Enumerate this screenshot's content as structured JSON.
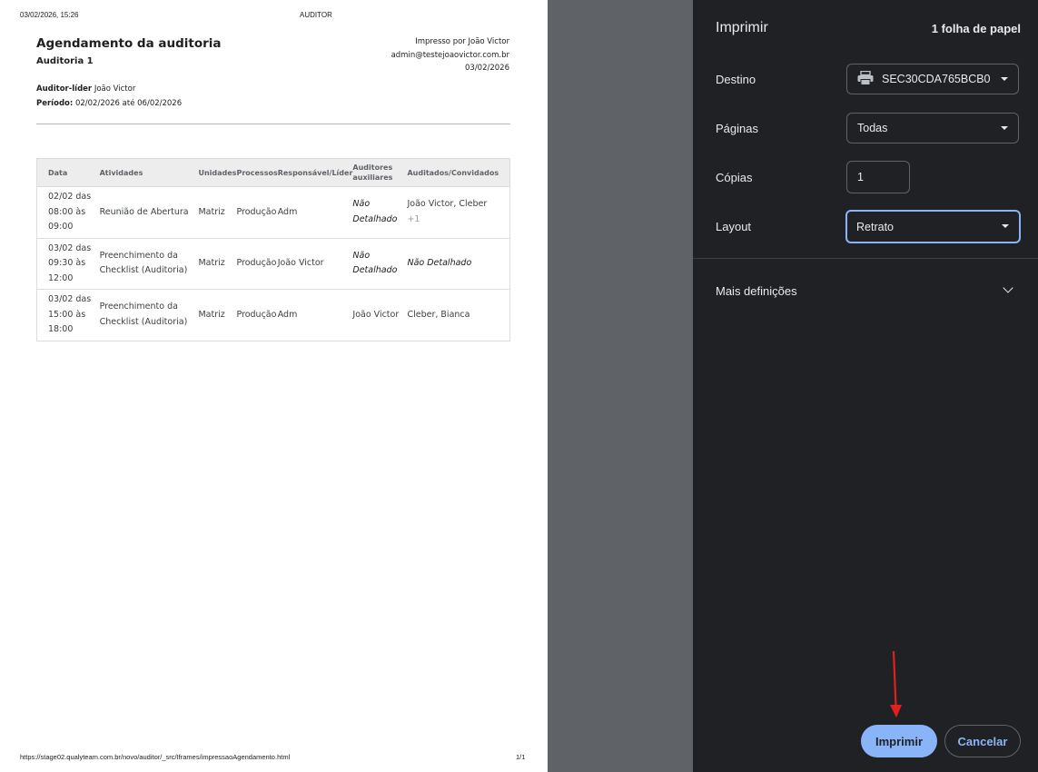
{
  "preview": {
    "header_datetime": "03/02/2026, 15:26",
    "header_title": "AUDITOR",
    "footer_url": "https://stage02.qualyteam.com.br/novo/auditor/_src/Iframes/impressaoAgendamento.html",
    "footer_page": "1/1",
    "title": "Agendamento da auditoria",
    "subtitle": "Auditoria 1",
    "printed_by": "Impresso por João Victor",
    "printed_email": "admin@testejoaovictor.com.br",
    "printed_date": "03/02/2026",
    "lead_label": "Auditor-líder",
    "lead_value": "João Victor",
    "period_label": "Período:",
    "period_value": "02/02/2026 até 06/02/2026",
    "table": {
      "headers": [
        "Data",
        "Atividades",
        "Unidades",
        "Processos",
        "Responsável/Líder",
        "Auditores auxiliares",
        "Auditados/Convidados"
      ],
      "rows": [
        {
          "data": "02/02 das 08:00 às 09:00",
          "atividade": "Reunião de Abertura",
          "unidade": "Matriz",
          "processo": "Produção",
          "responsavel": "Adm",
          "auxiliares": "Não Detalhado",
          "auditados": "João Victor, Cleber",
          "auditados_more": "+1"
        },
        {
          "data": "03/02 das 09:30 às 12:00",
          "atividade": "Preenchimento da Checklist (Auditoria)",
          "unidade": "Matriz",
          "processo": "Produção",
          "responsavel": "João Victor",
          "auxiliares": "Não Detalhado",
          "auditados": "Não Detalhado",
          "auditados_more": ""
        },
        {
          "data": "03/02 das 15:00 às 18:00",
          "atividade": "Preenchimento da Checklist (Auditoria)",
          "unidade": "Matriz",
          "processo": "Produção",
          "responsavel": "Adm",
          "auxiliares": "João Victor",
          "auditados": "Cleber, Bianca",
          "auditados_more": ""
        }
      ]
    }
  },
  "panel": {
    "title": "Imprimir",
    "sheets": "1 folha de papel",
    "destination_label": "Destino",
    "destination_value": "SEC30CDA765BCB0",
    "destination_icon": "printer-icon",
    "pages_label": "Páginas",
    "pages_value": "Todas",
    "copies_label": "Cópias",
    "copies_value": "1",
    "layout_label": "Layout",
    "layout_value": "Retrato",
    "more_settings": "Mais definições",
    "print_button": "Imprimir",
    "cancel_button": "Cancelar",
    "accent_color": "#8ab4f8",
    "annotation_color": "#e02020"
  }
}
